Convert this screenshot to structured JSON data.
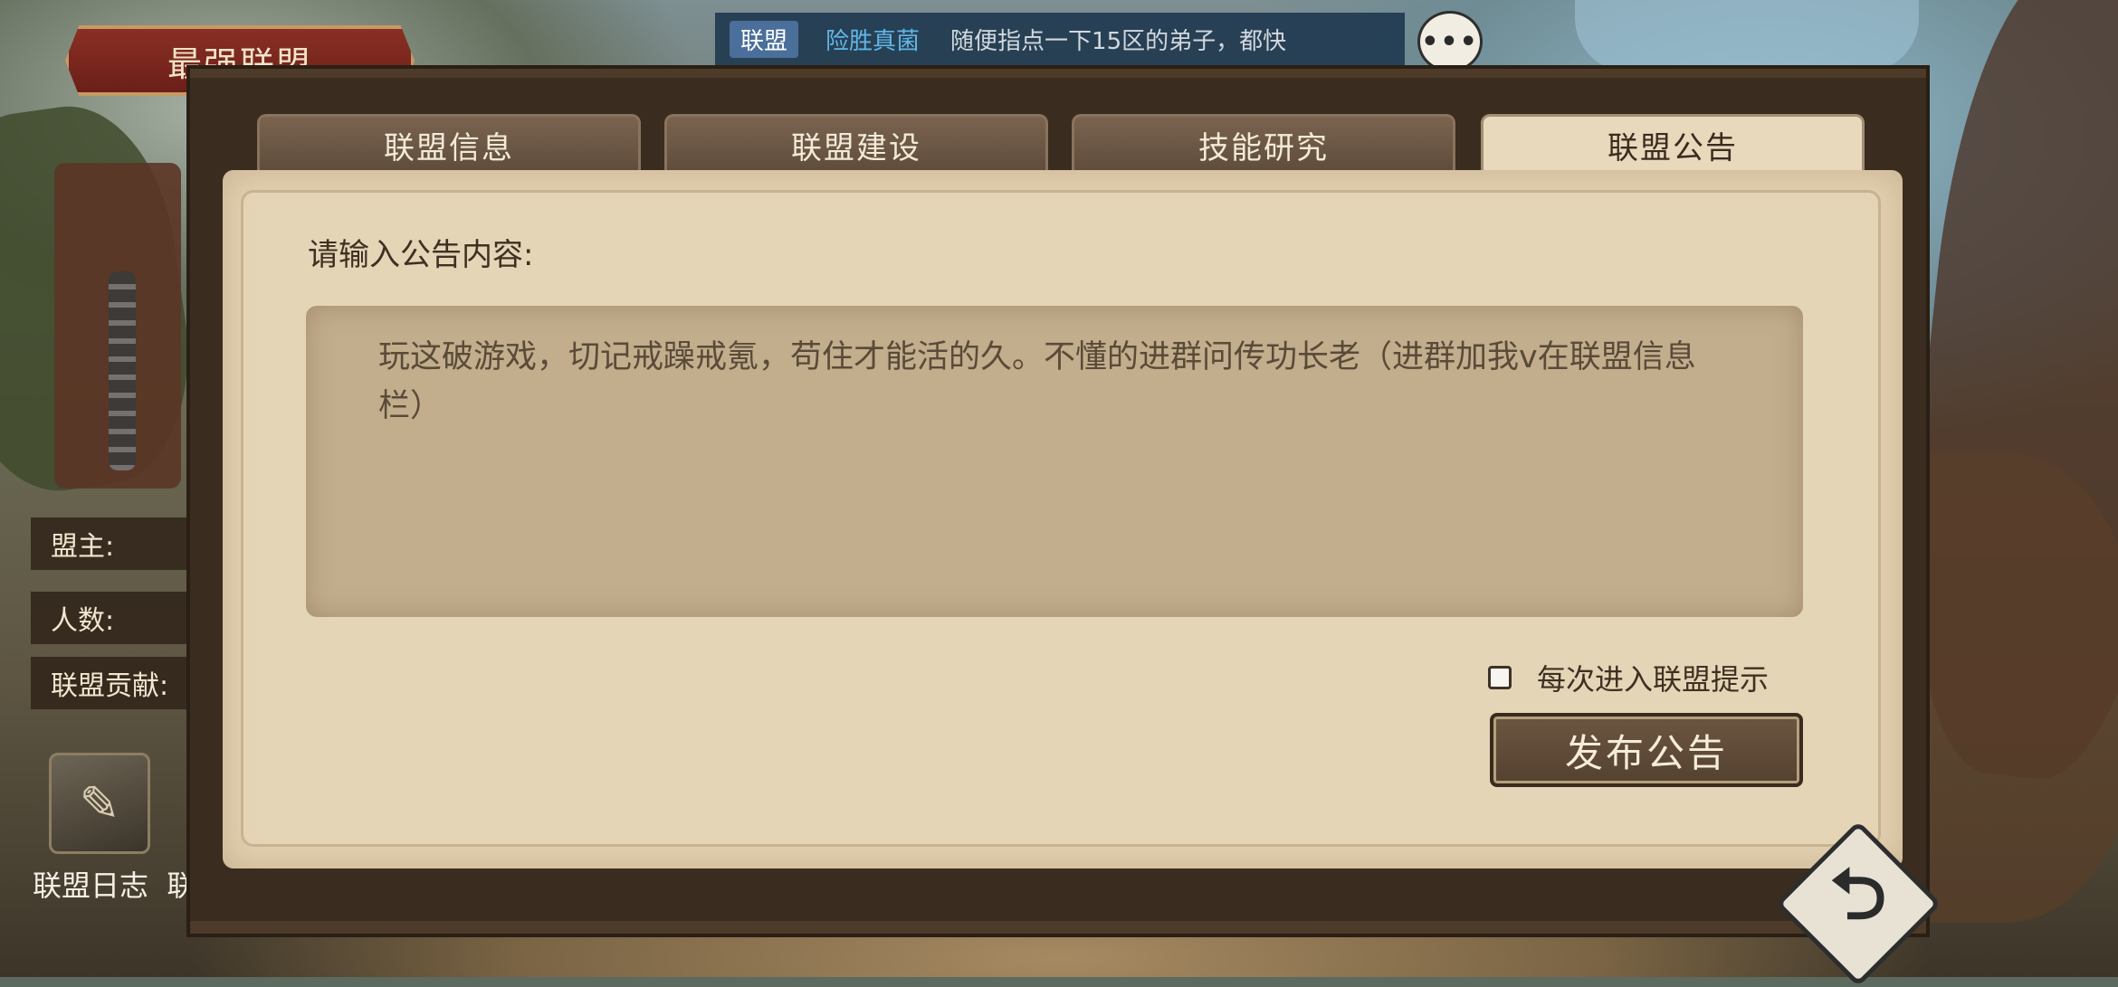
{
  "header": {
    "title": "最强联盟"
  },
  "chat": {
    "channel": "联盟",
    "sender": "险胜真菌",
    "message": "随便指点一下15区的弟子，都快",
    "more_icon": "more-dots-icon"
  },
  "side": {
    "leader_label": "盟主:",
    "members_label": "人数:",
    "contribution_label": "联盟贡献:",
    "log_label": "联盟日志",
    "log_overflow": "联",
    "log_icon": "scroll-icon"
  },
  "tabs": [
    {
      "label": "联盟信息",
      "active": false
    },
    {
      "label": "联盟建设",
      "active": false
    },
    {
      "label": "技能研究",
      "active": false
    },
    {
      "label": "联盟公告",
      "active": true
    }
  ],
  "announcement": {
    "prompt": "请输入公告内容:",
    "content": "玩这破游戏，切记戒躁戒氪，苟住才能活的久。不懂的进群问传功长老（进群加我v在联盟信息栏）",
    "remind_label": "每次进入联盟提示",
    "remind_checked": false,
    "publish_label": "发布公告"
  },
  "nav": {
    "back_icon": "return-arrow-icon"
  }
}
